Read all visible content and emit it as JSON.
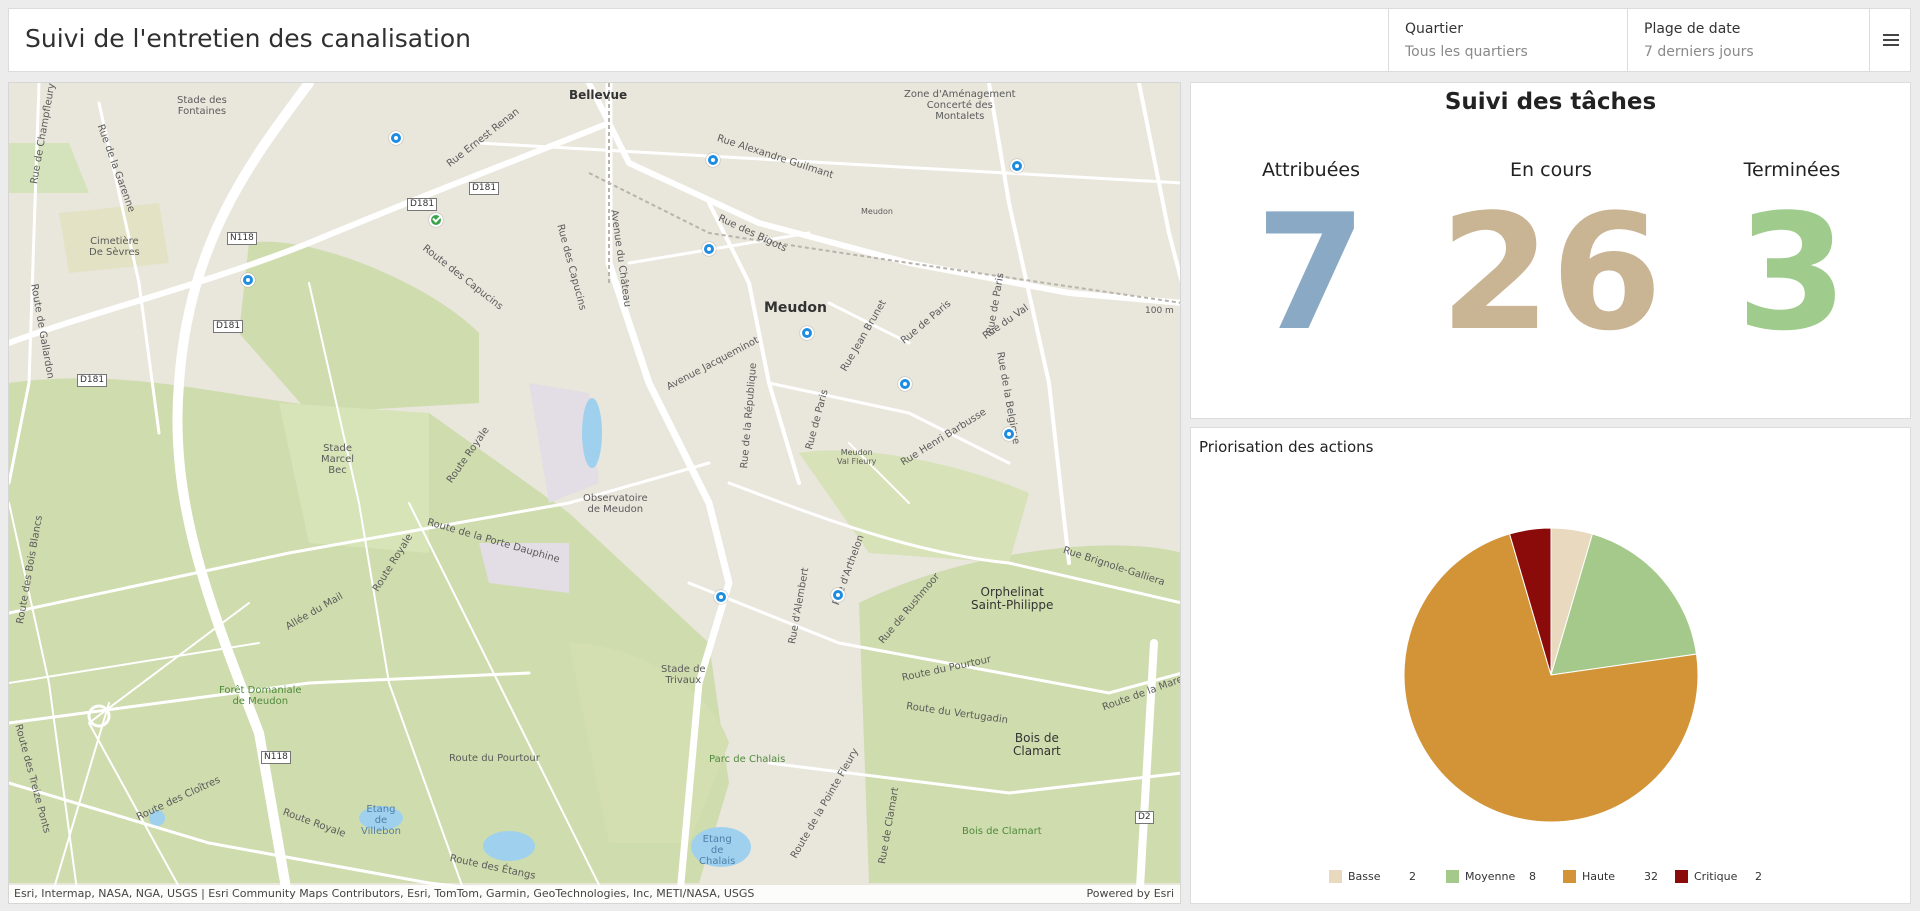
{
  "header": {
    "title": "Suivi de l'entretien des canalisation",
    "quartier": {
      "label": "Quartier",
      "value": "Tous les quartiers"
    },
    "date_range": {
      "label": "Plage de date",
      "value": "7 derniers jours"
    }
  },
  "map": {
    "labels": {
      "bellevue": "Bellevue",
      "stade_fontaines": "Stade des\nFontaines",
      "zone": "Zone d'Aménagement\nConcerté des\nMontalets",
      "cimetiere": "Cimetière\nDe Sèvres",
      "meudon": "Meudon",
      "meudon_station": "Meudon",
      "meudon_val": "Meudon\nVal Fleury",
      "stade_marcel": "Stade\nMarcel\nBec",
      "observatoire": "Observatoire\nde Meudon",
      "orphelinat": "Orphelinat\nSaint-Philippe",
      "stade_trivaux": "Stade de\nTrivaux",
      "foret": "Forêt Domaniale\nde Meudon",
      "parc_chalais": "Parc de Chalais",
      "bois_clamart": "Bois de\nClamart",
      "bois_clamart2": "Bois de Clamart",
      "etang_villebon": "Etang\nde\nVillebon",
      "etang_chalais": "Etang\nde\nChalais",
      "r_champfleury": "Rue de Champfleury",
      "r_garenne": "Rue de la Garenne",
      "r_capucins": "Route des Capucins",
      "r_capucins2": "Rue des Capucins",
      "av_chateau": "Avenue du Château",
      "r_guilmant": "Rue Alexandre Guilmant",
      "r_bigots": "Rue des Bigots",
      "av_jacqueminot": "Avenue Jacqueminot",
      "r_republique": "Rue de la République",
      "r_paris": "Rue de Paris",
      "r_jean_brunet": "Rue Jean Brunet",
      "r_val": "Rue du Val",
      "r_belgique": "Rue de la Belgique",
      "r_barbusse": "Rue Henri Barbusse",
      "r_porte_dauphine": "Route de la Porte Dauphine",
      "r_royale": "Route Royale",
      "allee_mail": "Allée du Mail",
      "r_arthelon": "Rue d'Arthelon",
      "r_alembert": "Rue d'Alembert",
      "r_rushmoor": "Rue de Rushmoor",
      "r_pourtour": "Route du Pourtour",
      "r_vertugadin": "Route du Vertugadin",
      "r_brignole": "Rue Brignole-Galliera",
      "r_mare": "Route de la Mare",
      "r_cloitres": "Route des Cloîtres",
      "r_etangs": "Route des Étangs",
      "r_bois_blancs": "Route des Bois Blancs",
      "r_gallardon": "Route de Gallardon",
      "r_ernest_renan": "Rue Ernest Renan",
      "r_pointe_fleury": "Route de la Pointe Fleury",
      "r_clamart": "Rue de Clamart",
      "r_trois_ponts": "Route des Treize Ponts",
      "scale": "100 m"
    },
    "shields": [
      "D181",
      "D181",
      "N118",
      "D181",
      "D181",
      "N118",
      "D2"
    ],
    "attribution": "Esri, Intermap, NASA, NGA, USGS | Esri Community Maps Contributors, Esri, TomTom, Garmin, GeoTechnologies, Inc, METI/NASA, USGS",
    "powered_by": "Powered by Esri"
  },
  "tasks": {
    "title": "Suivi des tâches",
    "kpis": [
      {
        "label": "Attribuées",
        "value": "7",
        "color": "#8aa9c4"
      },
      {
        "label": "En cours",
        "value": "26",
        "color": "#c9b494"
      },
      {
        "label": "Terminées",
        "value": "3",
        "color": "#9fcb8c"
      }
    ]
  },
  "priorisation": {
    "title": "Priorisation des actions"
  },
  "chart_data": {
    "type": "pie",
    "title": "Priorisation des actions",
    "categories": [
      "Basse",
      "Moyenne",
      "Haute",
      "Critique"
    ],
    "values": [
      2,
      8,
      32,
      2
    ],
    "colors": [
      "#e8d9bf",
      "#a5c98a",
      "#d39437",
      "#8b0a0a"
    ],
    "legend": "bottom"
  }
}
